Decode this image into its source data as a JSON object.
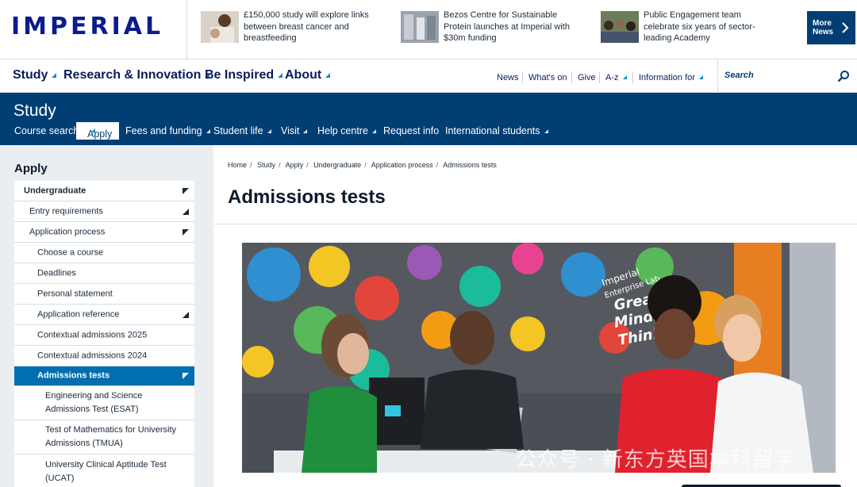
{
  "brand": {
    "logo_text": "IMPERIAL"
  },
  "news": {
    "items": [
      {
        "text": "£150,000 study will explore links between breast cancer and breastfeeding"
      },
      {
        "text": "Bezos Centre for Sustainable Protein launches at Imperial with $30m funding"
      },
      {
        "text": "Public Engagement team celebrate six years of sector-leading Academy"
      }
    ],
    "more_label": "More News"
  },
  "main_nav": {
    "items": [
      {
        "label": "Study"
      },
      {
        "label": "Research & Innovation"
      },
      {
        "label": "Be Inspired"
      },
      {
        "label": "About"
      }
    ],
    "utility": [
      {
        "label": "News"
      },
      {
        "label": "What's on"
      },
      {
        "label": "Give"
      },
      {
        "label": "A-z"
      },
      {
        "label": "Information for"
      }
    ],
    "search_placeholder": "Search"
  },
  "study_nav": {
    "title": "Study",
    "items": [
      {
        "label": "Course search"
      },
      {
        "label": "Apply"
      },
      {
        "label": "Fees and funding"
      },
      {
        "label": "Student life"
      },
      {
        "label": "Visit"
      },
      {
        "label": "Help centre"
      },
      {
        "label": "Request info"
      },
      {
        "label": "International students"
      }
    ]
  },
  "sidebar": {
    "title": "Apply",
    "items": [
      {
        "label": "Undergraduate"
      },
      {
        "label": "Entry requirements"
      },
      {
        "label": "Application process"
      },
      {
        "label": "Choose a course"
      },
      {
        "label": "Deadlines"
      },
      {
        "label": "Personal statement"
      },
      {
        "label": "Application reference"
      },
      {
        "label": "Contextual admissions 2025"
      },
      {
        "label": "Contextual admissions 2024"
      },
      {
        "label": "Admissions tests"
      },
      {
        "label": "Engineering and Science Admissions Test (ESAT)"
      },
      {
        "label": "Test of Mathematics for University Admissions (TMUA)"
      },
      {
        "label": "University Clinical Aptitude Test (UCAT)"
      }
    ]
  },
  "content": {
    "breadcrumbs": [
      "Home",
      "Study",
      "Apply",
      "Undergraduate",
      "Application process",
      "Admissions tests"
    ],
    "title": "Admissions tests",
    "hero_mural_text": [
      "Imperial",
      "Enterprise Lab",
      "Great",
      "Minds D",
      "Think A"
    ],
    "watermark": "公众号 · 新东方英国本科留学"
  },
  "colors": {
    "brand_navy": "#003e74",
    "logo_blue": "#0a1c8f",
    "accent_cyan": "#0b8dc7",
    "active_item": "#006eaf",
    "sidebar_bg": "#ebeef1"
  }
}
